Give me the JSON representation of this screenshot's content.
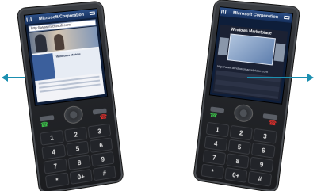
{
  "left_phone": {
    "status_title": "Microsoft Corporation",
    "address": "http://www.microsoft.com/",
    "page_title": "Windows Mobile",
    "keys": [
      "1",
      "2",
      "3",
      "4",
      "5",
      "6",
      "7",
      "8",
      "9",
      "*",
      "0+",
      "#"
    ]
  },
  "right_phone": {
    "status_title": "Microsoft Corporation",
    "hero_title": "Windows Marketplace",
    "url": "http://www.windowsmarketplace.com",
    "keys": [
      "1",
      "2",
      "3",
      "4",
      "5",
      "6",
      "7",
      "8",
      "9",
      "*",
      "0+",
      "#"
    ]
  },
  "arrows": {
    "color": "#1b8fb0",
    "left_direction": "left",
    "right_direction": "right"
  },
  "icons": [
    "signal-icon",
    "battery-icon",
    "call-icon",
    "end-call-icon",
    "arrow-left-icon",
    "arrow-right-icon"
  ]
}
